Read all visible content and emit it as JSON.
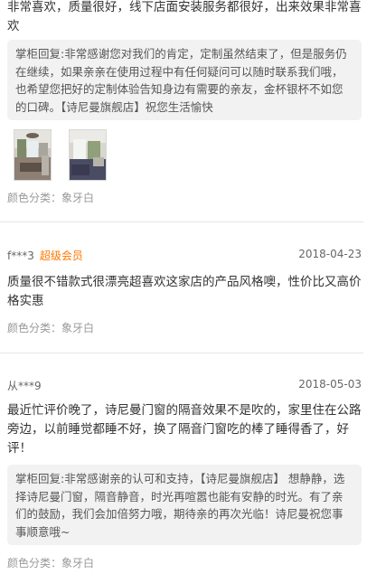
{
  "reviews": [
    {
      "text": "非常喜欢，质量很好，线下店面安装服务都很好，出来效果非常喜欢",
      "reply": "掌柜回复:非常感谢您对我们的肯定，定制虽然结束了，但是服务仍在继续，如果亲亲在使用过程中有任何疑问可以随时联系我们哦，也希望您把好的定制体验告知身边有需要的亲友，金杯银杯不如您的口碑。【诗尼曼旗舰店】祝您生活愉快",
      "photos": [
        "review-photo-1",
        "review-photo-2"
      ],
      "sku": "颜色分类：象牙白"
    },
    {
      "user": "f***3",
      "badge": "超级会员",
      "date": "2018-04-23",
      "text": "质量很不错款式很漂亮超喜欢这家店的产品风格噢，性价比又高价格实惠",
      "sku": "颜色分类：象牙白"
    },
    {
      "user": "从***9",
      "date": "2018-05-03",
      "text": "最近忙评价晚了，诗尼曼门窗的隔音效果不是吹的，家里住在公路旁边，以前睡觉都睡不好，换了隔音门窗吃的棒了睡得香了，好评！",
      "reply": "掌柜回复:非常感谢亲的认可和支持，【诗尼曼旗舰店】 想静静，选择诗尼曼门窗，隔音静音，时光再喧嚣也能有安静的时光。有了亲们的鼓励，我们会加倍努力哦，期待亲的再次光临！诗尼曼祝您事事顺意哦~",
      "sku": "颜色分类：象牙白"
    }
  ],
  "colors": {
    "badge": "#ff7700",
    "reply_bg": "#f2f2f2",
    "divider": "#e6e6e6"
  }
}
